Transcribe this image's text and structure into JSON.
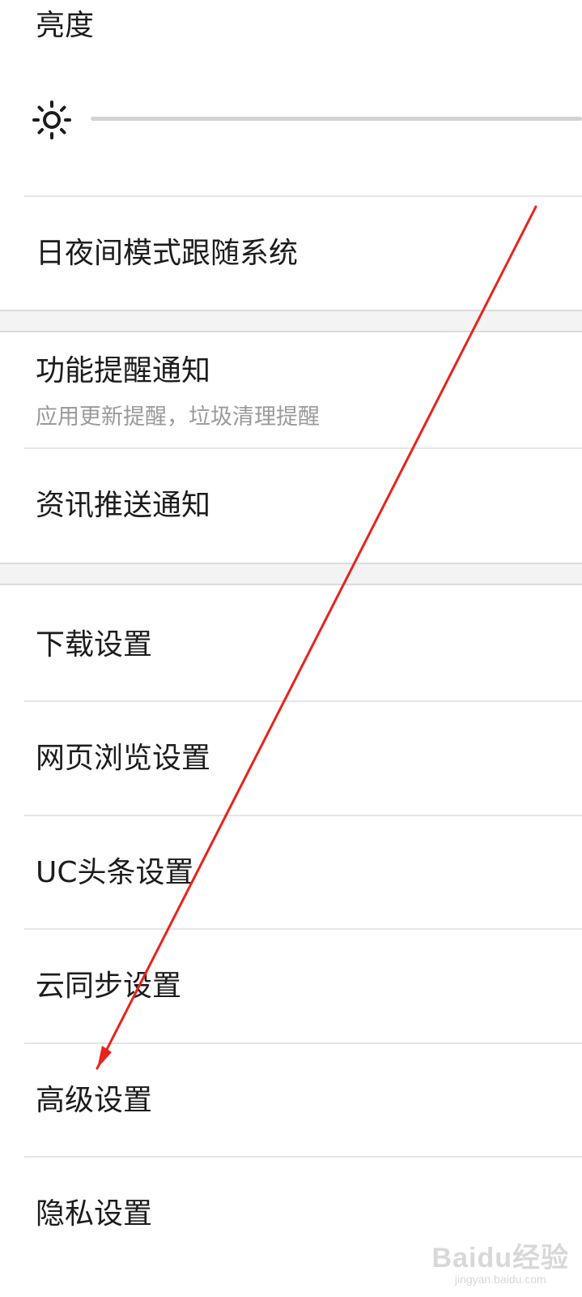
{
  "brightness": {
    "title": "亮度",
    "level": 0,
    "icon": "sun-icon"
  },
  "sections": {
    "night_mode_label": "日夜间模式跟随系统",
    "feature_notice": {
      "label": "功能提醒通知",
      "description": "应用更新提醒，垃圾清理提醒"
    },
    "news_push_label": "资讯推送通知",
    "items": [
      "下载设置",
      "网页浏览设置",
      "UC头条设置",
      "云同步设置",
      "高级设置",
      "隐私设置"
    ]
  },
  "annotation": {
    "color": "#e8231c",
    "icon": "red-arrow"
  },
  "watermark": {
    "brand": "Baidu经验",
    "domain": "jingyan.baidu.com"
  }
}
